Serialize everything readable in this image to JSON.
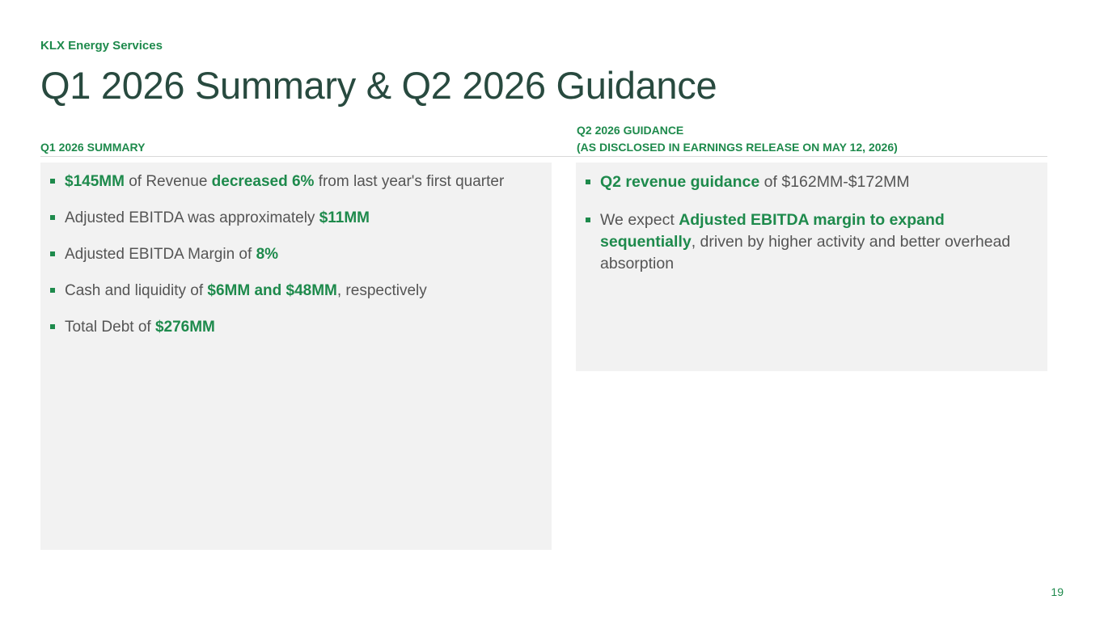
{
  "header": {
    "company": "KLX Energy Services",
    "title": "Q1 2026 Summary & Q2 2026 Guidance"
  },
  "summary": {
    "heading": "Q1 2026 SUMMARY",
    "items": [
      {
        "p1": "$145MM",
        "p2": " of Revenue ",
        "p3": "decreased 6%",
        "p4": " from last year's first quarter"
      },
      {
        "p1": "Adjusted EBITDA was approximately ",
        "p2": "$11MM"
      },
      {
        "p1": "Adjusted EBITDA Margin of ",
        "p2": "8%"
      },
      {
        "p1": "Cash and liquidity of ",
        "p2": "$6MM and $48MM",
        "p3": ", respectively"
      },
      {
        "p1": "Total Debt of ",
        "p2": "$276MM"
      }
    ]
  },
  "guidance": {
    "heading_line1": "Q2 2026 GUIDANCE",
    "heading_line2": "(AS DISCLOSED IN EARNINGS RELEASE ON MAY 12, 2026)",
    "items": [
      {
        "p1": "Q2 revenue guidance",
        "p2": " of $162MM-$172MM"
      },
      {
        "p1": "We expect ",
        "p2": "Adjusted EBITDA margin to expand sequentially",
        "p3": ", driven by higher activity and better overhead absorption"
      }
    ]
  },
  "footer": {
    "page_number": "19"
  },
  "colors": {
    "accent_green": "#1e8a4c",
    "title_dark_green": "#284a3f",
    "panel_gray": "#f2f2f2"
  }
}
